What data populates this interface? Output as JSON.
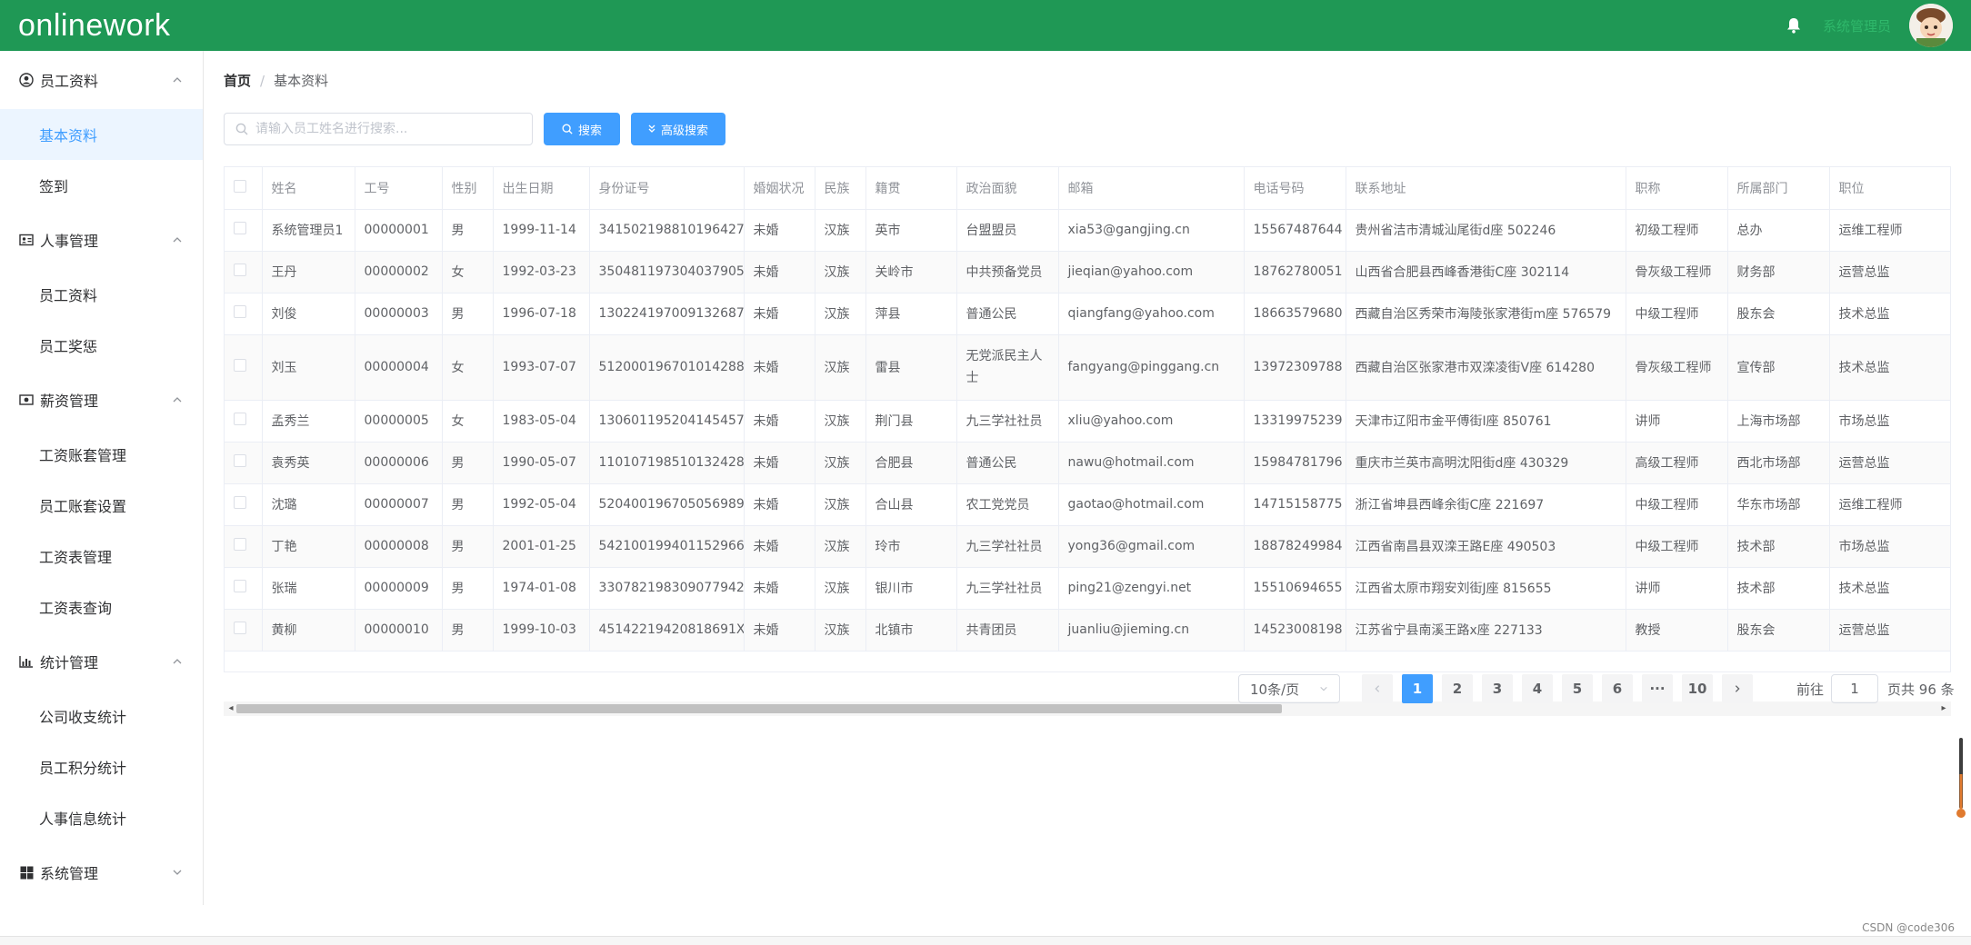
{
  "app": {
    "title": "onlinework",
    "user_name": "系统管理员"
  },
  "sidebar": {
    "groups": [
      {
        "title": "员工资料",
        "icon": "user-circle-icon",
        "items": [
          {
            "label": "基本资料",
            "active": true
          },
          {
            "label": "签到"
          }
        ]
      },
      {
        "title": "人事管理",
        "icon": "id-card-icon",
        "items": [
          {
            "label": "员工资料"
          },
          {
            "label": "员工奖惩"
          }
        ]
      },
      {
        "title": "薪资管理",
        "icon": "money-icon",
        "items": [
          {
            "label": "工资账套管理"
          },
          {
            "label": "员工账套设置"
          },
          {
            "label": "工资表管理"
          },
          {
            "label": "工资表查询"
          }
        ]
      },
      {
        "title": "统计管理",
        "icon": "bar-chart-icon",
        "items": [
          {
            "label": "公司收支统计"
          },
          {
            "label": "员工积分统计"
          },
          {
            "label": "人事信息统计"
          }
        ]
      },
      {
        "title": "系统管理",
        "icon": "windows-icon",
        "items": []
      }
    ]
  },
  "breadcrumb": {
    "home": "首页",
    "sep": "/",
    "current": "基本资料"
  },
  "search": {
    "placeholder": "请输入员工姓名进行搜索...",
    "search_label": "搜索",
    "advanced_label": "高级搜索"
  },
  "table": {
    "columns": [
      "姓名",
      "工号",
      "性别",
      "出生日期",
      "身份证号",
      "婚姻状况",
      "民族",
      "籍贯",
      "政治面貌",
      "邮箱",
      "电话号码",
      "联系地址",
      "职称",
      "所属部门",
      "职位"
    ],
    "rows": [
      [
        "系统管理员1",
        "00000001",
        "男",
        "1999-11-14",
        "341502198810196427",
        "未婚",
        "汉族",
        "英市",
        "台盟盟员",
        "xia53@gangjing.cn",
        "15567487644",
        "贵州省洁市清城汕尾街d座 502246",
        "初级工程师",
        "总办",
        "运维工程师"
      ],
      [
        "王丹",
        "00000002",
        "女",
        "1992-03-23",
        "350481197304037905",
        "未婚",
        "汉族",
        "关岭市",
        "中共预备党员",
        "jieqian@yahoo.com",
        "18762780051",
        "山西省合肥县西峰香港街C座 302114",
        "骨灰级工程师",
        "财务部",
        "运营总监"
      ],
      [
        "刘俊",
        "00000003",
        "男",
        "1996-07-18",
        "130224197009132687",
        "未婚",
        "汉族",
        "萍县",
        "普通公民",
        "qiangfang@yahoo.com",
        "18663579680",
        "西藏自治区秀荣市海陵张家港街m座 576579",
        "中级工程师",
        "股东会",
        "技术总监"
      ],
      [
        "刘玉",
        "00000004",
        "女",
        "1993-07-07",
        "512000196701014288",
        "未婚",
        "汉族",
        "雷县",
        "无党派民主人士",
        "fangyang@pinggang.cn",
        "13972309788",
        "西藏自治区张家港市双滦凌街V座 614280",
        "骨灰级工程师",
        "宣传部",
        "技术总监"
      ],
      [
        "孟秀兰",
        "00000005",
        "女",
        "1983-05-04",
        "130601195204145457",
        "未婚",
        "汉族",
        "荆门县",
        "九三学社社员",
        "xliu@yahoo.com",
        "13319975239",
        "天津市辽阳市金平傅街I座 850761",
        "讲师",
        "上海市场部",
        "市场总监"
      ],
      [
        "袁秀英",
        "00000006",
        "男",
        "1990-05-07",
        "110107198510132428",
        "未婚",
        "汉族",
        "合肥县",
        "普通公民",
        "nawu@hotmail.com",
        "15984781796",
        "重庆市兰英市高明沈阳街d座 430329",
        "高级工程师",
        "西北市场部",
        "运营总监"
      ],
      [
        "沈璐",
        "00000007",
        "男",
        "1992-05-04",
        "520400196705056989",
        "未婚",
        "汉族",
        "合山县",
        "农工党党员",
        "gaotao@hotmail.com",
        "14715158775",
        "浙江省坤县西峰余街C座 221697",
        "中级工程师",
        "华东市场部",
        "运维工程师"
      ],
      [
        "丁艳",
        "00000008",
        "男",
        "2001-01-25",
        "542100199401152966",
        "未婚",
        "汉族",
        "玲市",
        "九三学社社员",
        "yong36@gmail.com",
        "18878249984",
        "江西省南昌县双滦王路E座 490503",
        "中级工程师",
        "技术部",
        "市场总监"
      ],
      [
        "张瑞",
        "00000009",
        "男",
        "1974-01-08",
        "330782198309077942",
        "未婚",
        "汉族",
        "银川市",
        "九三学社社员",
        "ping21@zengyi.net",
        "15510694655",
        "江西省太原市翔安刘街J座 815655",
        "讲师",
        "技术部",
        "技术总监"
      ],
      [
        "黄柳",
        "00000010",
        "男",
        "1999-10-03",
        "45142219420818691X",
        "未婚",
        "汉族",
        "北镇市",
        "共青团员",
        "juanliu@jieming.cn",
        "14523008198",
        "江苏省宁县南溪王路x座 227133",
        "教授",
        "股东会",
        "运营总监"
      ]
    ]
  },
  "pagination": {
    "page_size": "10条/页",
    "pages": [
      "1",
      "2",
      "3",
      "4",
      "5",
      "6",
      "···",
      "10"
    ],
    "current": "1",
    "goto_label": "前往",
    "goto_value": "1",
    "total_label": "页共 96 条"
  },
  "watermark": "CSDN @code306",
  "colors": {
    "header": "#1f9855",
    "primary": "#409eff",
    "active_bg": "#ecf5ff"
  }
}
